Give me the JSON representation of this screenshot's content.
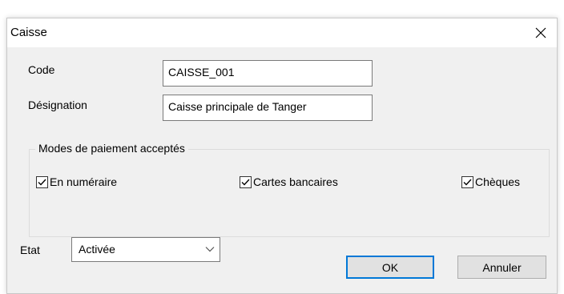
{
  "window": {
    "title": "Caisse"
  },
  "fields": {
    "code_label": "Code",
    "code_value": "CAISSE_001",
    "designation_label": "Désignation",
    "designation_value": "Caisse principale de Tanger"
  },
  "payment_group": {
    "legend": "Modes de paiement acceptés",
    "options": [
      {
        "label": "En numéraire",
        "checked": true
      },
      {
        "label": "Cartes bancaires",
        "checked": true
      },
      {
        "label": "Chèques",
        "checked": true
      }
    ]
  },
  "state": {
    "label": "Etat",
    "selected": "Activée"
  },
  "buttons": {
    "ok": "OK",
    "cancel": "Annuler"
  },
  "colors": {
    "accent": "#0078d7",
    "dialog_bg": "#f0f0f0"
  },
  "icons": {
    "close": "close-icon",
    "check": "checkmark-icon",
    "dropdown": "chevron-down-icon"
  }
}
